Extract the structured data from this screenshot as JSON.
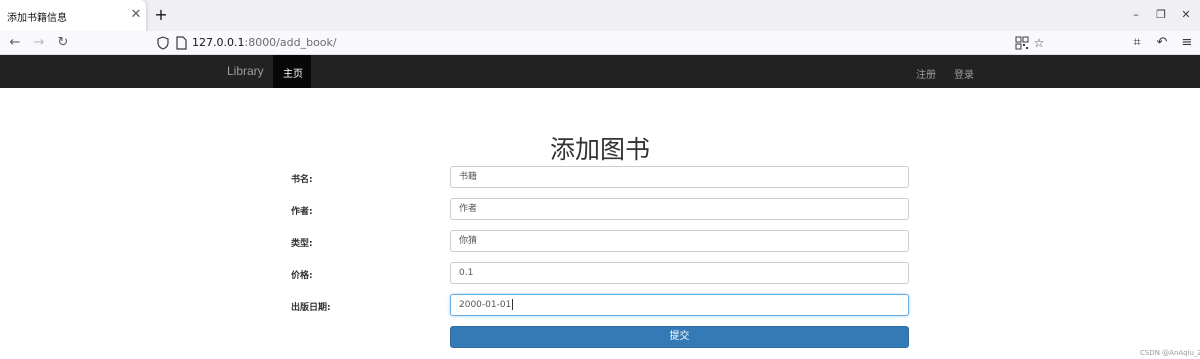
{
  "browser": {
    "tab_title": "添加书籍信息",
    "tab_close": "✕",
    "new_tab": "+",
    "url_host": "127.0.0.1",
    "url_rest": ":8000/add_book/",
    "icons": [
      "back-arrow-icon",
      "forward-arrow-icon",
      "reload-icon",
      "shield-icon",
      "page-icon",
      "qr-code-icon",
      "star-icon",
      "crop-icon",
      "undo-icon",
      "menu-icon",
      "minimize-icon",
      "restore-icon",
      "close-icon"
    ]
  },
  "site_nav": {
    "brand": "Library",
    "active_item": "主页",
    "register": "注册",
    "login": "登录"
  },
  "form": {
    "heading": "添加图书",
    "fields": [
      {
        "label": "书名:",
        "value": "书籍"
      },
      {
        "label": "作者:",
        "value": "作者"
      },
      {
        "label": "类型:",
        "value": "你猜"
      },
      {
        "label": "价格:",
        "value": "0.1"
      },
      {
        "label": "出版日期:",
        "value": "2000-01-01"
      }
    ],
    "submit_label": "提交"
  },
  "watermark": "CSDN @AnAqiu_Z",
  "colors": {
    "navbar_bg": "#222222",
    "navbar_active_bg": "#080808",
    "button_primary": "#337ab7",
    "focus_border": "#66afe9"
  }
}
